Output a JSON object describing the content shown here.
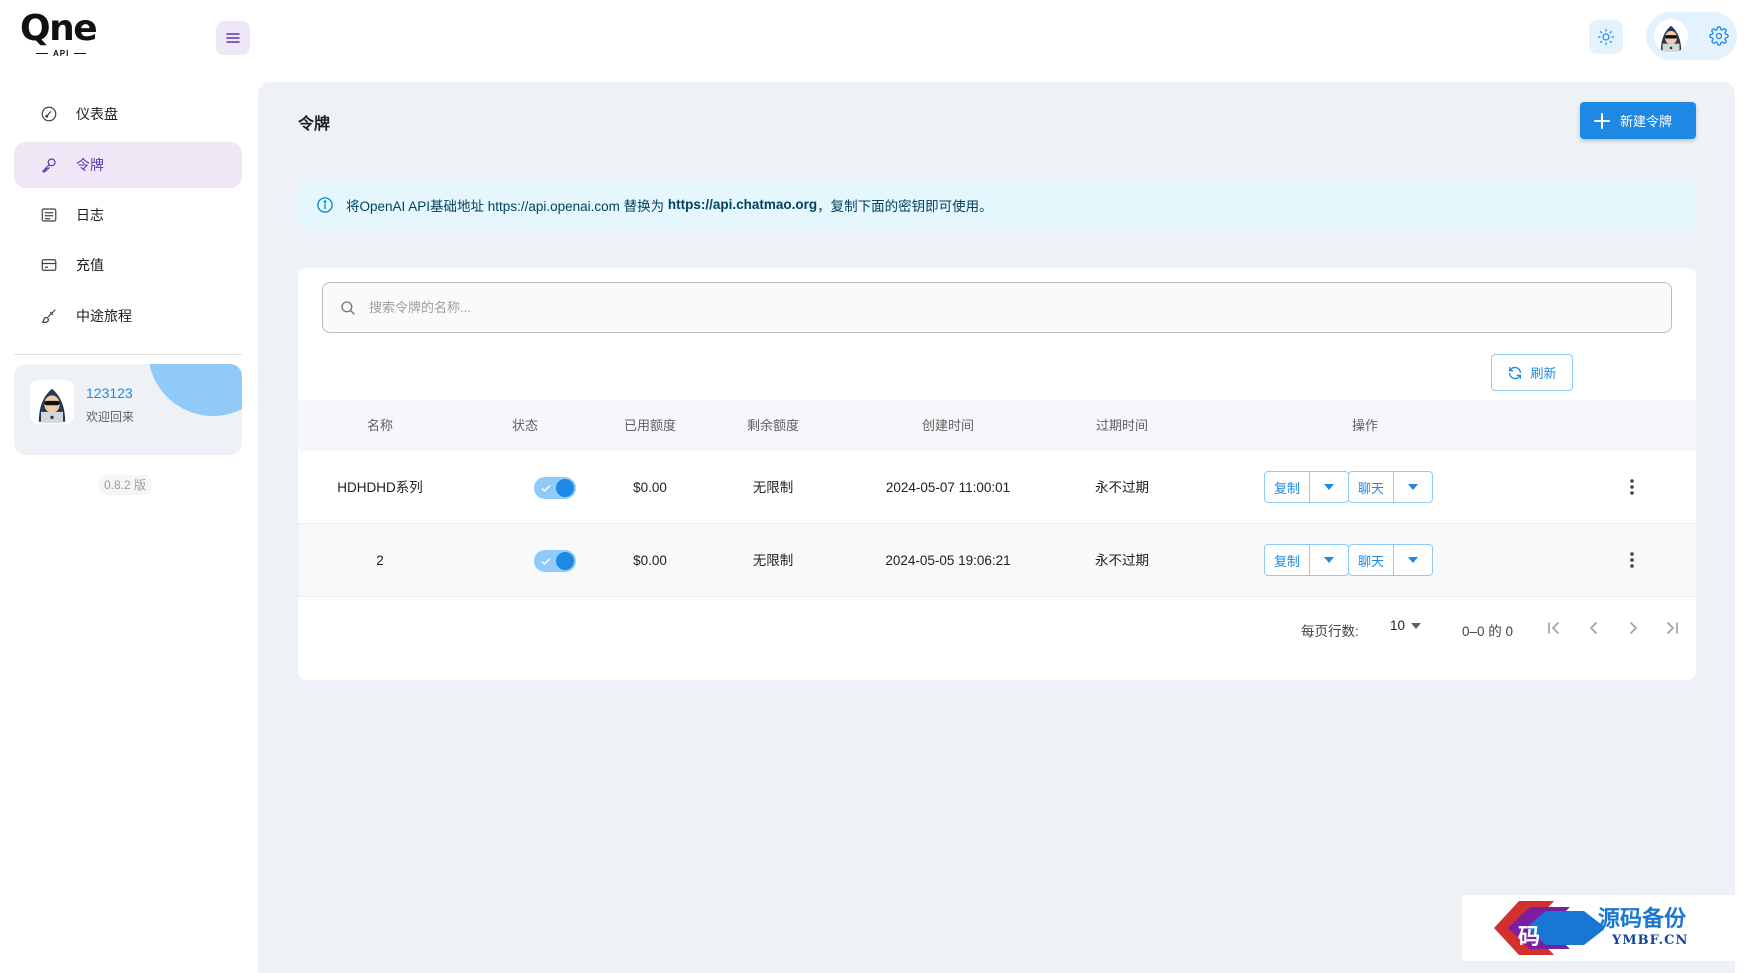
{
  "brand": {
    "logo_text": "Qne",
    "logo_sub": "API"
  },
  "colors": {
    "primary": "#1e88e5",
    "secondary": "#5e35b1",
    "main_bg": "#eef2f6",
    "active_nav_bg": "#ede7f6",
    "info_bg": "#e5f6fd"
  },
  "header": {
    "menu_icon": "menu-icon",
    "theme_icon": "sun-icon",
    "settings_icon": "gear-icon"
  },
  "sidebar": {
    "items": [
      {
        "label": "仪表盘",
        "icon": "dashboard-icon",
        "active": false
      },
      {
        "label": "令牌",
        "icon": "key-icon",
        "active": true
      },
      {
        "label": "日志",
        "icon": "log-icon",
        "active": false
      },
      {
        "label": "充值",
        "icon": "card-icon",
        "active": false
      },
      {
        "label": "中途旅程",
        "icon": "brush-icon",
        "active": false
      }
    ],
    "user": {
      "name": "123123",
      "welcome": "欢迎回来"
    },
    "version": "0.8.2 版"
  },
  "main": {
    "title": "令牌",
    "new_button": "新建令牌",
    "notice": {
      "prefix": "将OpenAI API基础地址 https://api.openai.com 替换为 ",
      "highlight": "https://api.chatmao.org",
      "suffix": "，复制下面的密钥即可使用。"
    },
    "search": {
      "placeholder": "搜索令牌的名称..."
    },
    "refresh_label": "刷新",
    "table": {
      "columns": [
        "名称",
        "状态",
        "已用额度",
        "剩余额度",
        "创建时间",
        "过期时间",
        "操作"
      ],
      "rows": [
        {
          "name": "HDHDHD系列",
          "enabled": true,
          "used": "$0.00",
          "remaining": "无限制",
          "created": "2024-05-07 11:00:01",
          "expires": "永不过期",
          "copy_label": "复制",
          "chat_label": "聊天"
        },
        {
          "name": "2",
          "enabled": true,
          "used": "$0.00",
          "remaining": "无限制",
          "created": "2024-05-05 19:06:21",
          "expires": "永不过期",
          "copy_label": "复制",
          "chat_label": "聊天"
        }
      ]
    },
    "pagination": {
      "rows_per_page_label": "每页行数:",
      "rows_per_page": "10",
      "range": "0–0 的 0"
    }
  },
  "watermark": {
    "title": "源码备份",
    "sub": "YMBF.CN",
    "glyph": "码"
  }
}
